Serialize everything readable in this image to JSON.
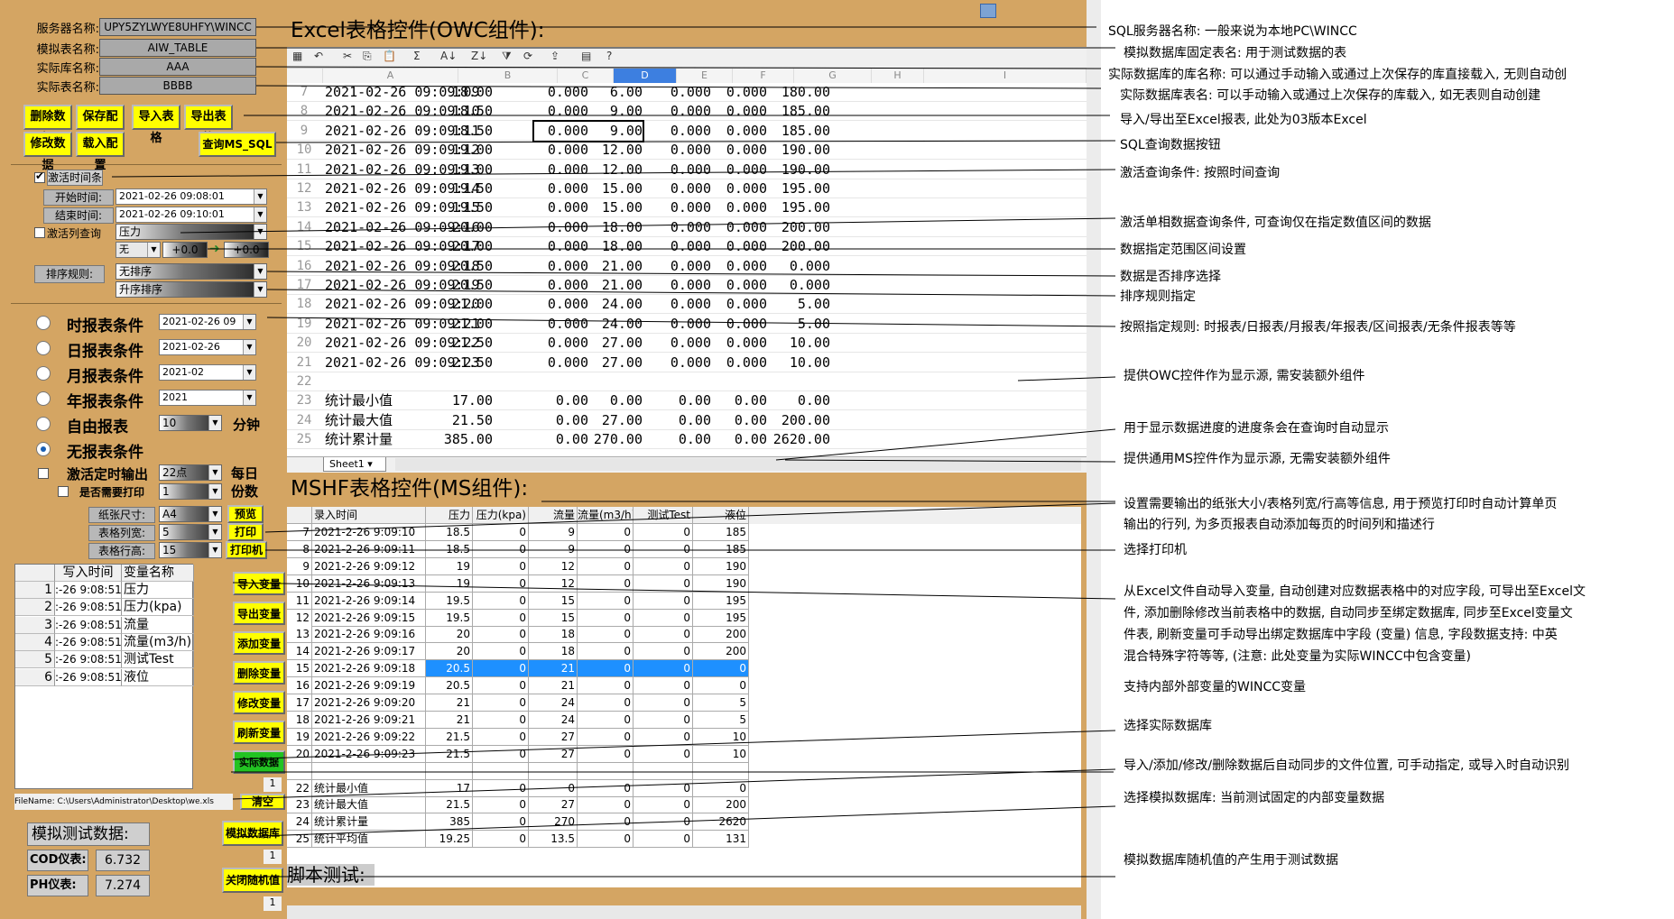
{
  "left": {
    "server_label": "服务器名称:",
    "server_value": "UPY5ZYLWYE8UHFY\\WINCC",
    "simtable_label": "模拟表名称:",
    "simtable_value": "AIW_TABLE",
    "db_label": "实际库名称:",
    "db_value": "AAA",
    "tbl_label": "实际表名称:",
    "tbl_value": "BBBB",
    "buttons": {
      "delete": "删除数据",
      "save": "保存配置",
      "import_tbl": "导入表格",
      "export_tbl": "导出表格",
      "modify": "修改数据",
      "load": "载入配置",
      "query": "查询MS_SQL"
    },
    "time_cond": "激活时间条",
    "start_label": "开始时间:",
    "start_value": "2021-02-26 09:08:01",
    "end_label": "结束时间:",
    "end_value": "2021-02-26 09:10:01",
    "col_query": "激活列查询",
    "col_value": "压力",
    "range_none": "无",
    "range_a": "+0.0",
    "range_b": "+0.0",
    "sort_label": "排序规则:",
    "sort_value": "无排序",
    "sort_order": "升序排序",
    "reports": [
      {
        "label": "时报表条件",
        "value": "2021-02-26 09"
      },
      {
        "label": "日报表条件",
        "value": "2021-02-26"
      },
      {
        "label": "月报表条件",
        "value": "2021-02"
      },
      {
        "label": "年报表条件",
        "value": "2021"
      },
      {
        "label": "自由报表",
        "value": "10",
        "unit": "分钟"
      },
      {
        "label": "无报表条件",
        "value": ""
      }
    ],
    "timed_output": "激活定时输出",
    "timed_value": "22点",
    "daily": "每日",
    "copies": "份数",
    "need_print": "是否需要打印",
    "copies_value": "1",
    "paper_label": "纸张尺寸:",
    "paper_value": "A4",
    "colw_label": "表格列宽:",
    "colw_value": "5",
    "rowh_label": "表格行高:",
    "rowh_value": "15",
    "preview": "预览",
    "print": "打印",
    "printer": "打印机",
    "var_headers": [
      "写入时间",
      "变量名称"
    ],
    "vars": [
      {
        "n": "1",
        "t": ":-26 9:08:51",
        "v": "压力"
      },
      {
        "n": "2",
        "t": ":-26 9:08:51",
        "v": "压力(kpa)"
      },
      {
        "n": "3",
        "t": ":-26 9:08:51",
        "v": "流量"
      },
      {
        "n": "4",
        "t": ":-26 9:08:51",
        "v": "流量(m3/h)"
      },
      {
        "n": "5",
        "t": ":-26 9:08:51",
        "v": "测试Test"
      },
      {
        "n": "6",
        "t": ":-26 9:08:51",
        "v": "液位"
      }
    ],
    "var_buttons": [
      "导入变量",
      "导出变量",
      "添加变量",
      "删除变量",
      "修改变量",
      "刷新变量",
      "实际数据库"
    ],
    "count_1": "1",
    "filename": "FileName: C:\\Users\\Administrator\\Desktop\\we.xls",
    "clear": "清空",
    "sim_title": "模拟测试数据:",
    "cod_label": "COD仪表:",
    "cod_value": "6.732",
    "ph_label": "PH仪表:",
    "ph_value": "7.274",
    "sim_db": "模拟数据库",
    "count_2": "1",
    "close_rand": "关闭随机值",
    "count_3": "1"
  },
  "excel": {
    "title": "Excel表格控件(OWC组件):",
    "columns": [
      "A",
      "B",
      "C",
      "D",
      "E",
      "F",
      "G",
      "H",
      "I"
    ],
    "rows": [
      {
        "n": "7",
        "a": "2021-02-26 09:09:09",
        "b": "18.00",
        "c": "0.000",
        "d": "6.00",
        "e": "0.000",
        "f": "0.000",
        "g": "180.00"
      },
      {
        "n": "8",
        "a": "2021-02-26 09:09:10",
        "b": "18.50",
        "c": "0.000",
        "d": "9.00",
        "e": "0.000",
        "f": "0.000",
        "g": "185.00"
      },
      {
        "n": "9",
        "a": "2021-02-26 09:09:11",
        "b": "18.50",
        "c": "0.000",
        "d": "9.00",
        "e": "0.000",
        "f": "0.000",
        "g": "185.00"
      },
      {
        "n": "10",
        "a": "2021-02-26 09:09:12",
        "b": "19.00",
        "c": "0.000",
        "d": "12.00",
        "e": "0.000",
        "f": "0.000",
        "g": "190.00"
      },
      {
        "n": "11",
        "a": "2021-02-26 09:09:13",
        "b": "19.00",
        "c": "0.000",
        "d": "12.00",
        "e": "0.000",
        "f": "0.000",
        "g": "190.00"
      },
      {
        "n": "12",
        "a": "2021-02-26 09:09:14",
        "b": "19.50",
        "c": "0.000",
        "d": "15.00",
        "e": "0.000",
        "f": "0.000",
        "g": "195.00"
      },
      {
        "n": "13",
        "a": "2021-02-26 09:09:15",
        "b": "19.50",
        "c": "0.000",
        "d": "15.00",
        "e": "0.000",
        "f": "0.000",
        "g": "195.00"
      },
      {
        "n": "14",
        "a": "2021-02-26 09:09:16",
        "b": "20.00",
        "c": "0.000",
        "d": "18.00",
        "e": "0.000",
        "f": "0.000",
        "g": "200.00"
      },
      {
        "n": "15",
        "a": "2021-02-26 09:09:17",
        "b": "20.00",
        "c": "0.000",
        "d": "18.00",
        "e": "0.000",
        "f": "0.000",
        "g": "200.00"
      },
      {
        "n": "16",
        "a": "2021-02-26 09:09:18",
        "b": "20.50",
        "c": "0.000",
        "d": "21.00",
        "e": "0.000",
        "f": "0.000",
        "g": "0.000"
      },
      {
        "n": "17",
        "a": "2021-02-26 09:09:19",
        "b": "20.50",
        "c": "0.000",
        "d": "21.00",
        "e": "0.000",
        "f": "0.000",
        "g": "0.000"
      },
      {
        "n": "18",
        "a": "2021-02-26 09:09:20",
        "b": "21.00",
        "c": "0.000",
        "d": "24.00",
        "e": "0.000",
        "f": "0.000",
        "g": "5.00"
      },
      {
        "n": "19",
        "a": "2021-02-26 09:09:21",
        "b": "21.00",
        "c": "0.000",
        "d": "24.00",
        "e": "0.000",
        "f": "0.000",
        "g": "5.00"
      },
      {
        "n": "20",
        "a": "2021-02-26 09:09:22",
        "b": "21.50",
        "c": "0.000",
        "d": "27.00",
        "e": "0.000",
        "f": "0.000",
        "g": "10.00"
      },
      {
        "n": "21",
        "a": "2021-02-26 09:09:23",
        "b": "21.50",
        "c": "0.000",
        "d": "27.00",
        "e": "0.000",
        "f": "0.000",
        "g": "10.00"
      },
      {
        "n": "22",
        "a": "",
        "b": "",
        "c": "",
        "d": "",
        "e": "",
        "f": "",
        "g": ""
      },
      {
        "n": "23",
        "a": "统计最小值",
        "b": "17.00",
        "c": "0.00",
        "d": "0.00",
        "e": "0.00",
        "f": "0.00",
        "g": "0.00"
      },
      {
        "n": "24",
        "a": "统计最大值",
        "b": "21.50",
        "c": "0.00",
        "d": "27.00",
        "e": "0.00",
        "f": "0.00",
        "g": "200.00"
      },
      {
        "n": "25",
        "a": "统计累计量",
        "b": "385.00",
        "c": "0.00",
        "d": "270.00",
        "e": "0.00",
        "f": "0.00",
        "g": "2620.00"
      }
    ],
    "sheet_tab": "Sheet1"
  },
  "mshf": {
    "title": "MSHF表格控件(MS组件):",
    "headers": [
      "录入时间",
      "压力",
      "压力(kpa)",
      "流量",
      "流量(m3/h)",
      "测试Test",
      "液位"
    ],
    "rows": [
      {
        "n": "7",
        "t": "2021-2-26 9:09:10",
        "p": "18.5",
        "pk": "0",
        "f": "9",
        "fm": "0",
        "x": "0",
        "l": "185"
      },
      {
        "n": "8",
        "t": "2021-2-26 9:09:11",
        "p": "18.5",
        "pk": "0",
        "f": "9",
        "fm": "0",
        "x": "0",
        "l": "185"
      },
      {
        "n": "9",
        "t": "2021-2-26 9:09:12",
        "p": "19",
        "pk": "0",
        "f": "12",
        "fm": "0",
        "x": "0",
        "l": "190"
      },
      {
        "n": "10",
        "t": "2021-2-26 9:09:13",
        "p": "19",
        "pk": "0",
        "f": "12",
        "fm": "0",
        "x": "0",
        "l": "190"
      },
      {
        "n": "11",
        "t": "2021-2-26 9:09:14",
        "p": "19.5",
        "pk": "0",
        "f": "15",
        "fm": "0",
        "x": "0",
        "l": "195"
      },
      {
        "n": "12",
        "t": "2021-2-26 9:09:15",
        "p": "19.5",
        "pk": "0",
        "f": "15",
        "fm": "0",
        "x": "0",
        "l": "195"
      },
      {
        "n": "13",
        "t": "2021-2-26 9:09:16",
        "p": "20",
        "pk": "0",
        "f": "18",
        "fm": "0",
        "x": "0",
        "l": "200"
      },
      {
        "n": "14",
        "t": "2021-2-26 9:09:17",
        "p": "20",
        "pk": "0",
        "f": "18",
        "fm": "0",
        "x": "0",
        "l": "200"
      },
      {
        "n": "15",
        "t": "2021-2-26 9:09:18",
        "p": "20.5",
        "pk": "0",
        "f": "21",
        "fm": "0",
        "x": "0",
        "l": "0"
      },
      {
        "n": "16",
        "t": "2021-2-26 9:09:19",
        "p": "20.5",
        "pk": "0",
        "f": "21",
        "fm": "0",
        "x": "0",
        "l": "0"
      },
      {
        "n": "17",
        "t": "2021-2-26 9:09:20",
        "p": "21",
        "pk": "0",
        "f": "24",
        "fm": "0",
        "x": "0",
        "l": "5"
      },
      {
        "n": "18",
        "t": "2021-2-26 9:09:21",
        "p": "21",
        "pk": "0",
        "f": "24",
        "fm": "0",
        "x": "0",
        "l": "5"
      },
      {
        "n": "19",
        "t": "2021-2-26 9:09:22",
        "p": "21.5",
        "pk": "0",
        "f": "27",
        "fm": "0",
        "x": "0",
        "l": "10"
      },
      {
        "n": "20",
        "t": "2021-2-26 9:09:23",
        "p": "21.5",
        "pk": "0",
        "f": "27",
        "fm": "0",
        "x": "0",
        "l": "10"
      },
      {
        "n": "",
        "t": "",
        "p": "",
        "pk": "",
        "f": "",
        "fm": "",
        "x": "",
        "l": ""
      },
      {
        "n": "22",
        "t": "统计最小值",
        "p": "17",
        "pk": "0",
        "f": "0",
        "fm": "0",
        "x": "0",
        "l": "0"
      },
      {
        "n": "23",
        "t": "统计最大值",
        "p": "21.5",
        "pk": "0",
        "f": "27",
        "fm": "0",
        "x": "0",
        "l": "200"
      },
      {
        "n": "24",
        "t": "统计累计量",
        "p": "385",
        "pk": "0",
        "f": "270",
        "fm": "0",
        "x": "0",
        "l": "2620"
      },
      {
        "n": "25",
        "t": "统计平均值",
        "p": "19.25",
        "pk": "0",
        "f": "13.5",
        "fm": "0",
        "x": "0",
        "l": "131"
      }
    ],
    "script_label": "脚本测试:"
  },
  "annotations": [
    "SQL服务器名称: 一般来说为本地PC\\WINCC",
    "模拟数据库固定表名: 用于测试数据的表",
    "实际数据库的库名称: 可以通过手动输入或通过上次保存的库直接载入, 无则自动创",
    "实际数据库表名: 可以手动输入或通过上次保存的库载入, 如无表则自动创建",
    "导入/导出至Excel报表, 此处为03版本Excel",
    "SQL查询数据按钮",
    "激活查询条件: 按照时间查询",
    "激活单相数据查询条件, 可查询仅在指定数值区间的数据",
    "数据指定范围区间设置",
    "数据是否排序选择",
    "排序规则指定",
    "按照指定规则: 时报表/日报表/月报表/年报表/区间报表/无条件报表等等",
    "提供OWC控件作为显示源, 需安装额外组件",
    "用于显示数据进度的进度条会在查询时自动显示",
    "提供通用MS控件作为显示源, 无需安装额外组件",
    "设置需要输出的纸张大小/表格列宽/行高等信息, 用于预览打印时自动计算单页",
    "输出的行列, 为多页报表自动添加每页的时间列和描述行",
    "选择打印机",
    "从Excel文件自动导入变量, 自动创建对应数据表格中的对应字段, 可导出至Excel文",
    "件, 添加删除修改当前表格中的数据, 自动同步至绑定数据库, 同步至Excel变量文",
    "件表, 刷新变量可手动导出绑定数据库中字段 (变量) 信息, 字段数据支持: 中英",
    "混合特殊字符等等, (注意: 此处变量为实际WINCC中包含变量)",
    "支持内部外部变量的WINCC变量",
    "选择实际数据库",
    "导入/添加/修改/删除数据后自动同步的文件位置, 可手动指定, 或导入时自动识别",
    "选择模拟数据库: 当前测试固定的内部变量数据",
    "模拟数据库随机值的产生用于测试数据"
  ],
  "colors": {
    "panel": "#d4a563",
    "button": "#ffff00",
    "selection": "#1e90ff"
  }
}
